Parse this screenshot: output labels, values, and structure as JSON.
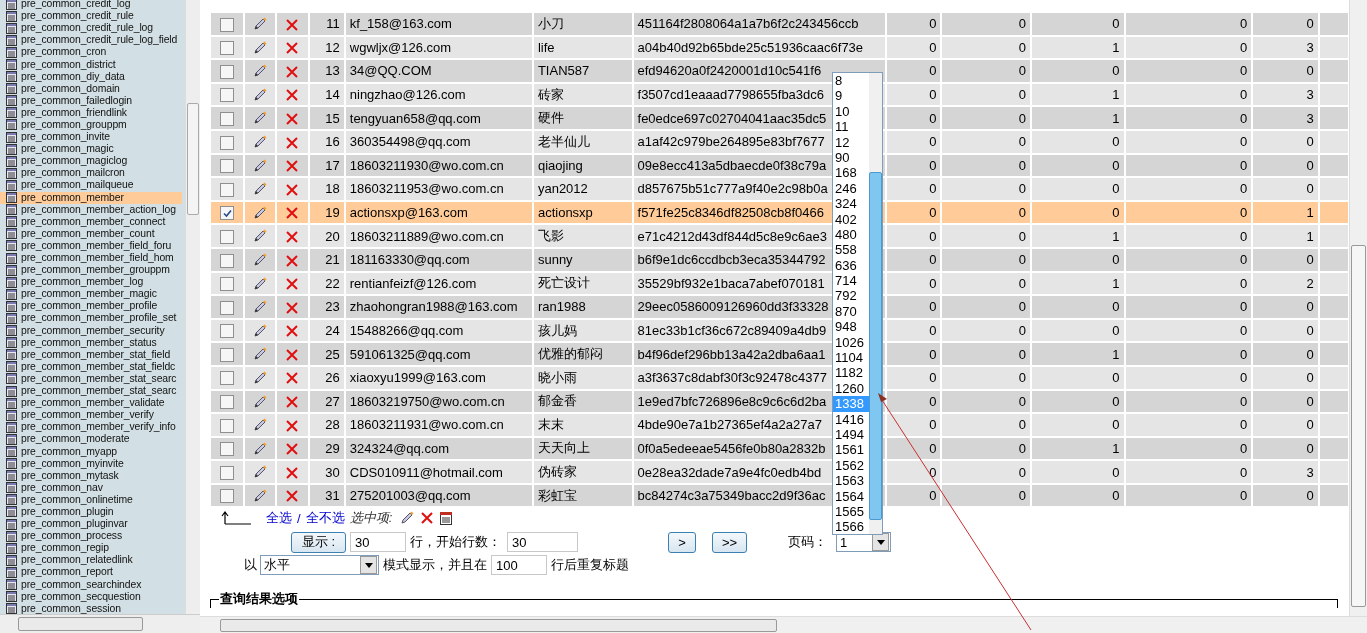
{
  "sidebar": {
    "tables": [
      {
        "name": "pre_common_credit_log",
        "selected": false
      },
      {
        "name": "pre_common_credit_rule",
        "selected": false
      },
      {
        "name": "pre_common_credit_rule_log",
        "selected": false
      },
      {
        "name": "pre_common_credit_rule_log_field",
        "selected": false
      },
      {
        "name": "pre_common_cron",
        "selected": false
      },
      {
        "name": "pre_common_district",
        "selected": false
      },
      {
        "name": "pre_common_diy_data",
        "selected": false
      },
      {
        "name": "pre_common_domain",
        "selected": false
      },
      {
        "name": "pre_common_failedlogin",
        "selected": false
      },
      {
        "name": "pre_common_friendlink",
        "selected": false
      },
      {
        "name": "pre_common_grouppm",
        "selected": false
      },
      {
        "name": "pre_common_invite",
        "selected": false
      },
      {
        "name": "pre_common_magic",
        "selected": false
      },
      {
        "name": "pre_common_magiclog",
        "selected": false
      },
      {
        "name": "pre_common_mailcron",
        "selected": false
      },
      {
        "name": "pre_common_mailqueue",
        "selected": false
      },
      {
        "name": "pre_common_member",
        "selected": true
      },
      {
        "name": "pre_common_member_action_log",
        "selected": false
      },
      {
        "name": "pre_common_member_connect",
        "selected": false
      },
      {
        "name": "pre_common_member_count",
        "selected": false
      },
      {
        "name": "pre_common_member_field_foru",
        "selected": false
      },
      {
        "name": "pre_common_member_field_hom",
        "selected": false
      },
      {
        "name": "pre_common_member_grouppm",
        "selected": false
      },
      {
        "name": "pre_common_member_log",
        "selected": false
      },
      {
        "name": "pre_common_member_magic",
        "selected": false
      },
      {
        "name": "pre_common_member_profile",
        "selected": false
      },
      {
        "name": "pre_common_member_profile_set",
        "selected": false
      },
      {
        "name": "pre_common_member_security",
        "selected": false
      },
      {
        "name": "pre_common_member_status",
        "selected": false
      },
      {
        "name": "pre_common_member_stat_field",
        "selected": false
      },
      {
        "name": "pre_common_member_stat_fieldc",
        "selected": false
      },
      {
        "name": "pre_common_member_stat_searc",
        "selected": false
      },
      {
        "name": "pre_common_member_stat_searc",
        "selected": false
      },
      {
        "name": "pre_common_member_validate",
        "selected": false
      },
      {
        "name": "pre_common_member_verify",
        "selected": false
      },
      {
        "name": "pre_common_member_verify_info",
        "selected": false
      },
      {
        "name": "pre_common_moderate",
        "selected": false
      },
      {
        "name": "pre_common_myapp",
        "selected": false
      },
      {
        "name": "pre_common_myinvite",
        "selected": false
      },
      {
        "name": "pre_common_mytask",
        "selected": false
      },
      {
        "name": "pre_common_nav",
        "selected": false
      },
      {
        "name": "pre_common_onlinetime",
        "selected": false
      },
      {
        "name": "pre_common_plugin",
        "selected": false
      },
      {
        "name": "pre_common_pluginvar",
        "selected": false
      },
      {
        "name": "pre_common_process",
        "selected": false
      },
      {
        "name": "pre_common_regip",
        "selected": false
      },
      {
        "name": "pre_common_relatedlink",
        "selected": false
      },
      {
        "name": "pre_common_report",
        "selected": false
      },
      {
        "name": "pre_common_searchindex",
        "selected": false
      },
      {
        "name": "pre_common_secquestion",
        "selected": false
      },
      {
        "name": "pre_common_session",
        "selected": false
      }
    ]
  },
  "table": {
    "rows": [
      {
        "checked": false,
        "cells": [
          "11",
          "kf_158@163.com",
          "小刀",
          "451164f2808064a1a7b6f2c243456ccb",
          "0",
          "0",
          "0",
          "0",
          "0"
        ]
      },
      {
        "checked": false,
        "cells": [
          "12",
          "wgwljx@126.com",
          "life",
          "a04b40d92b65bde25c51936caac6f73e",
          "0",
          "0",
          "1",
          "0",
          "3"
        ]
      },
      {
        "checked": false,
        "cells": [
          "13",
          "34@QQ.COM",
          "TIAN587",
          "efd94620a0f2420001d10c541f6",
          "0",
          "0",
          "0",
          "0",
          "0"
        ]
      },
      {
        "checked": false,
        "cells": [
          "14",
          "ningzhao@126.com",
          "砖家",
          "f3507cd1eaaad7798655fba3dc6",
          "0",
          "0",
          "1",
          "0",
          "3"
        ]
      },
      {
        "checked": false,
        "cells": [
          "15",
          "tengyuan658@qq.com",
          "硬件",
          "fe0edce697c02704041aac35dc5",
          "0",
          "0",
          "1",
          "0",
          "3"
        ]
      },
      {
        "checked": false,
        "cells": [
          "16",
          "360354498@qq.com",
          "老半仙儿",
          "a1af42c979be264895e83bf7677",
          "0",
          "0",
          "0",
          "0",
          "0"
        ]
      },
      {
        "checked": false,
        "cells": [
          "17",
          "18603211930@wo.com.cn",
          "qiaojing",
          "09e8ecc413a5dbaecde0f38c79a",
          "0",
          "0",
          "0",
          "0",
          "0"
        ]
      },
      {
        "checked": false,
        "cells": [
          "18",
          "18603211953@wo.com.cn",
          "yan2012",
          "d857675b51c777a9f40e2c98b0a",
          "0",
          "0",
          "0",
          "0",
          "0"
        ]
      },
      {
        "checked": true,
        "cells": [
          "19",
          "actionsxp@163.com",
          "actionsxp",
          "f571fe25c8346df82508cb8f0466",
          "0",
          "0",
          "0",
          "0",
          "1"
        ]
      },
      {
        "checked": false,
        "cells": [
          "20",
          "18603211889@wo.com.cn",
          "飞影",
          "e71c4212d43df844d5c8e9c6ae3",
          "0",
          "0",
          "1",
          "0",
          "1"
        ]
      },
      {
        "checked": false,
        "cells": [
          "21",
          "181163330@qq.com",
          "sunny",
          "b6f9e1dc6ccdbcb3eca35344792",
          "0",
          "0",
          "0",
          "0",
          "0"
        ]
      },
      {
        "checked": false,
        "cells": [
          "22",
          "rentianfeizf@126.com",
          "死亡设计",
          "35529bf932e1baca7abef070181",
          "0",
          "0",
          "1",
          "0",
          "2"
        ]
      },
      {
        "checked": false,
        "cells": [
          "23",
          "zhaohongran1988@163.com",
          "ran1988",
          "29eec0586009126960dd3f33328",
          "0",
          "0",
          "0",
          "0",
          "0"
        ]
      },
      {
        "checked": false,
        "cells": [
          "24",
          "15488266@qq.com",
          "孩儿妈",
          "81ec33b1cf36c672c89409a4db9",
          "0",
          "0",
          "0",
          "0",
          "0"
        ]
      },
      {
        "checked": false,
        "cells": [
          "25",
          "591061325@qq.com",
          "优雅的郁闷",
          "b4f96def296bb13a42a2dba6aa1",
          "0",
          "0",
          "1",
          "0",
          "0"
        ]
      },
      {
        "checked": false,
        "cells": [
          "26",
          "xiaoxyu1999@163.com",
          "晓小雨",
          "a3f3637c8dabf30f3c92478c4377",
          "0",
          "0",
          "0",
          "0",
          "0"
        ]
      },
      {
        "checked": false,
        "cells": [
          "27",
          "18603219750@wo.com.cn",
          "郁金香",
          "1e9ed7bfc726896e8c9c6c6d2ba",
          "0",
          "0",
          "0",
          "0",
          "0"
        ]
      },
      {
        "checked": false,
        "cells": [
          "28",
          "18603211931@wo.com.cn",
          "末末",
          "4bde90e7a1b27365ef4a2a27a7",
          "0",
          "0",
          "0",
          "0",
          "0"
        ]
      },
      {
        "checked": false,
        "cells": [
          "29",
          "324324@qq.com",
          "天天向上",
          "0f0a5edeeae5456fe0b80a2832b",
          "0",
          "0",
          "1",
          "0",
          "0"
        ]
      },
      {
        "checked": false,
        "cells": [
          "30",
          "CDS010911@hotmail.com",
          "伪砖家",
          "0e28ea32dade7a9e4fc0edb4bd",
          "0",
          "0",
          "0",
          "0",
          "3"
        ]
      },
      {
        "checked": false,
        "cells": [
          "31",
          "275201003@qq.com",
          "彩虹宝",
          "bc84274c3a75349bacc2d9f36ac",
          "0",
          "0",
          "0",
          "0",
          "0"
        ]
      }
    ]
  },
  "bulk": {
    "select_all": "全选",
    "separator": "/",
    "deselect_all": "全不选",
    "with_selected": "选中项:"
  },
  "paging": {
    "show_button": "显示 :",
    "rows": "30",
    "rows_label": "行，开始行数：",
    "start": "30",
    "next_button": ">",
    "last_button": ">>",
    "page_label": "页码：",
    "page": "1",
    "page_options": [
      {
        "label": "8",
        "selected": false
      },
      {
        "label": "9",
        "selected": false
      },
      {
        "label": "10",
        "selected": false
      },
      {
        "label": "11",
        "selected": false
      },
      {
        "label": "12",
        "selected": false
      },
      {
        "label": "90",
        "selected": false
      },
      {
        "label": "168",
        "selected": false
      },
      {
        "label": "246",
        "selected": false
      },
      {
        "label": "324",
        "selected": false
      },
      {
        "label": "402",
        "selected": false
      },
      {
        "label": "480",
        "selected": false
      },
      {
        "label": "558",
        "selected": false
      },
      {
        "label": "636",
        "selected": false
      },
      {
        "label": "714",
        "selected": false
      },
      {
        "label": "792",
        "selected": false
      },
      {
        "label": "870",
        "selected": false
      },
      {
        "label": "948",
        "selected": false
      },
      {
        "label": "1026",
        "selected": false
      },
      {
        "label": "1104",
        "selected": false
      },
      {
        "label": "1182",
        "selected": false
      },
      {
        "label": "1260",
        "selected": false
      },
      {
        "label": "1338",
        "selected": true
      },
      {
        "label": "1416",
        "selected": false
      },
      {
        "label": "1494",
        "selected": false
      },
      {
        "label": "1561",
        "selected": false
      },
      {
        "label": "1562",
        "selected": false
      },
      {
        "label": "1563",
        "selected": false
      },
      {
        "label": "1564",
        "selected": false
      },
      {
        "label": "1565",
        "selected": false
      },
      {
        "label": "1566",
        "selected": false
      }
    ]
  },
  "display": {
    "prefix": "以",
    "mode": "水平",
    "mode_label": "模式显示，并且在",
    "repeat": "100",
    "repeat_label": "行后重复标题"
  },
  "query_options": {
    "legend": "查询结果选项"
  }
}
